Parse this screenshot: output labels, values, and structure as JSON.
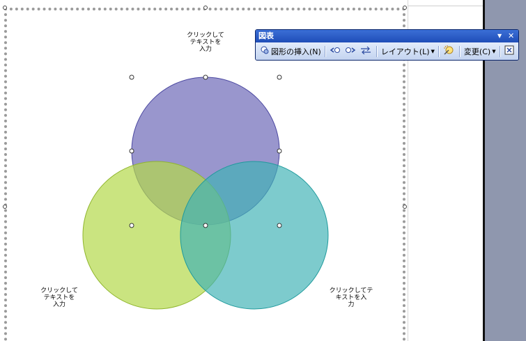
{
  "toolbar": {
    "title": "図表",
    "menu_caret": "▼",
    "close_glyph": "✕",
    "insert_shape": "図形の挿入(N)",
    "layout": "レイアウト(L)",
    "change": "変更(C)"
  },
  "diagram": {
    "type": "venn",
    "circle_colors": [
      "#8a86c7",
      "#bfde5e",
      "#5fc3c4"
    ],
    "labels": {
      "top": [
        "クリックして",
        "テキストを",
        "入力"
      ],
      "left": [
        "クリックして",
        "テキストを",
        "入力"
      ],
      "right": [
        "クリックしてテ",
        "キストを入",
        "力"
      ]
    }
  }
}
